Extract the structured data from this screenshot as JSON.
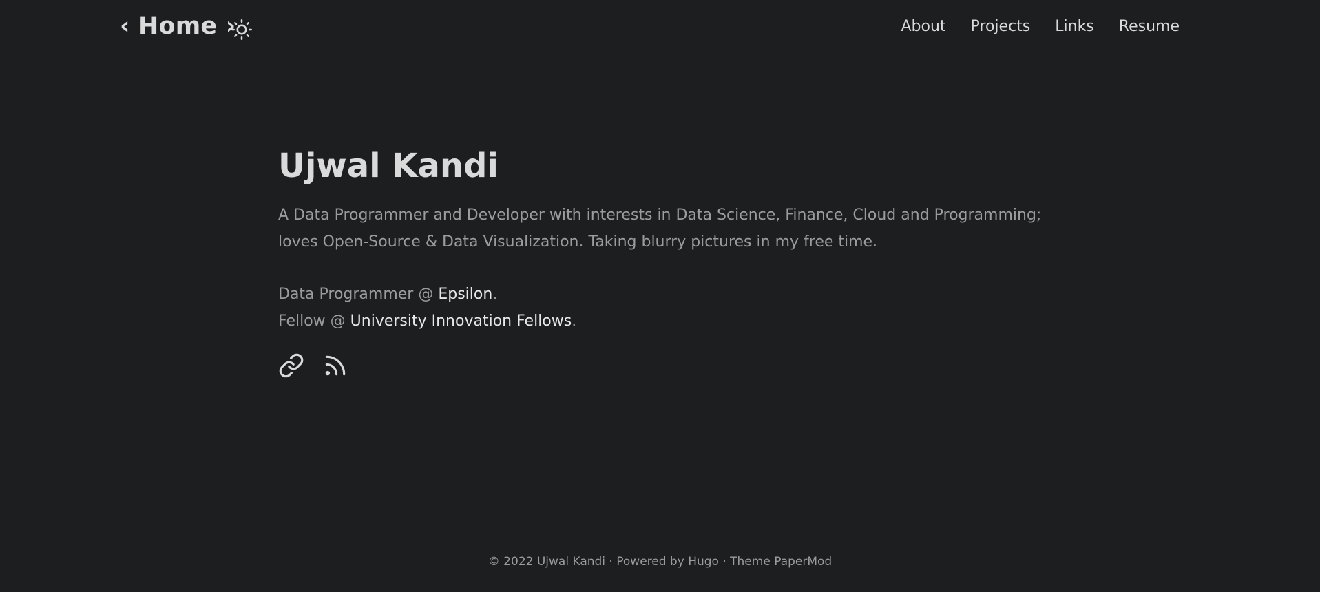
{
  "header": {
    "logo_label": "‹ Home ›",
    "theme_toggle_icon": "sun-icon",
    "nav": [
      {
        "label": "About"
      },
      {
        "label": "Projects"
      },
      {
        "label": "Links"
      },
      {
        "label": "Resume"
      }
    ]
  },
  "profile": {
    "name": "Ujwal Kandi",
    "description": "A Data Programmer and Developer with interests in Data Science, Finance, Cloud and Programming; loves Open-Source & Data Visualization. Taking blurry pictures in my free time.",
    "roles": [
      {
        "prefix": "Data Programmer @ ",
        "link": "Epsilon",
        "suffix": "."
      },
      {
        "prefix": "Fellow @ ",
        "link": "University Innovation Fellows",
        "suffix": "."
      }
    ],
    "social_icons": [
      "link-icon",
      "rss-icon"
    ]
  },
  "footer": {
    "copyright": "© 2022 ",
    "author_link": "Ujwal Kandi",
    "sep1": " · ",
    "powered_by": "Powered by ",
    "hugo_link": "Hugo",
    "theme_text": " · Theme ",
    "theme_link": "PaperMod"
  },
  "colors": {
    "background": "#1d1e20",
    "primary_text": "#dadadb",
    "secondary_text": "#9b9c9d"
  }
}
